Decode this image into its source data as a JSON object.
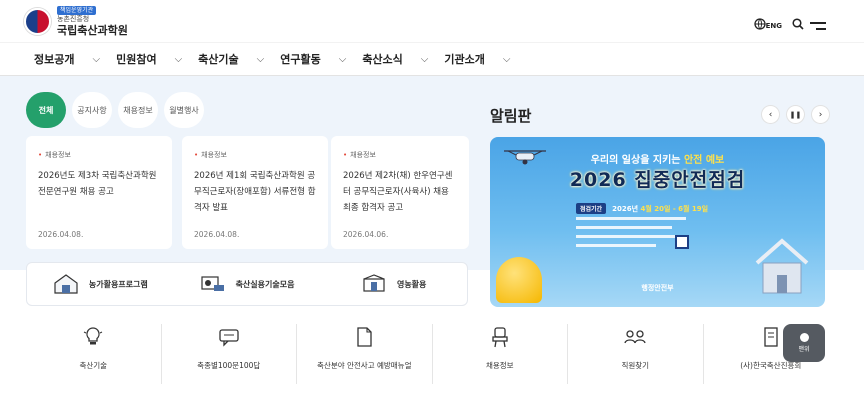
{
  "header": {
    "badge": "책임운영기관",
    "ministry": "농촌진흥청",
    "name": "국립축산과학원",
    "lang": "ENG"
  },
  "gnb": [
    {
      "label": "정보공개"
    },
    {
      "label": "민원참여"
    },
    {
      "label": "축산기술"
    },
    {
      "label": "연구활동"
    },
    {
      "label": "축산소식"
    },
    {
      "label": "기관소개"
    }
  ],
  "tabs": [
    {
      "label": "전체",
      "active": true
    },
    {
      "label": "공지사항"
    },
    {
      "label": "채용정보"
    },
    {
      "label": "월별행사"
    }
  ],
  "cards": [
    {
      "tag": "채용정보",
      "title": "2026년도 제3차 국립축산과학원 전문연구원 채용 공고",
      "date": "2026.04.08."
    },
    {
      "tag": "채용정보",
      "title": "2026년 제1회 국립축산과학원 공무직근로자(장애포함) 서류전형 합격자 발표",
      "date": "2026.04.08."
    },
    {
      "tag": "채용정보",
      "title": "2026년 제2차(채) 한우연구센터 공무직근로자(사육사) 채용 최종 합격자 공고",
      "date": "2026.04.06."
    }
  ],
  "board": {
    "title": "알림판",
    "banner": {
      "subtitle_prefix": "우리의 일상을 지키는 ",
      "subtitle_highlight": "안전 예보",
      "title": "2026 집중안전점검",
      "period_label": "점검기간",
      "period_prefix": "2026년 ",
      "period_value": "4월 20일 - 6월 19일",
      "ministry": "행정안전부"
    }
  },
  "quick_links": [
    {
      "label": "농가활용프로그램",
      "icon": "farm-house-icon"
    },
    {
      "label": "축산실용기술모음",
      "icon": "livestock-tech-icon"
    },
    {
      "label": "영농활용",
      "icon": "farming-icon"
    }
  ],
  "services": [
    {
      "label": "축산기술",
      "icon": "lightbulb-icon"
    },
    {
      "label": "축종별100문100답",
      "icon": "chat-bubble-icon"
    },
    {
      "label": "축산분야 안전사고 예방매뉴얼",
      "icon": "document-icon"
    },
    {
      "label": "채용정보",
      "icon": "chair-icon"
    },
    {
      "label": "직원찾기",
      "icon": "people-icon"
    },
    {
      "label": "(사)한국축산진흥회",
      "icon": "book-icon"
    }
  ],
  "top_button": {
    "label": "맨위"
  },
  "colors": {
    "accent_green": "#24a06b",
    "hero_bg": "#eef4fb",
    "banner_blue": "#4aa4e6"
  }
}
